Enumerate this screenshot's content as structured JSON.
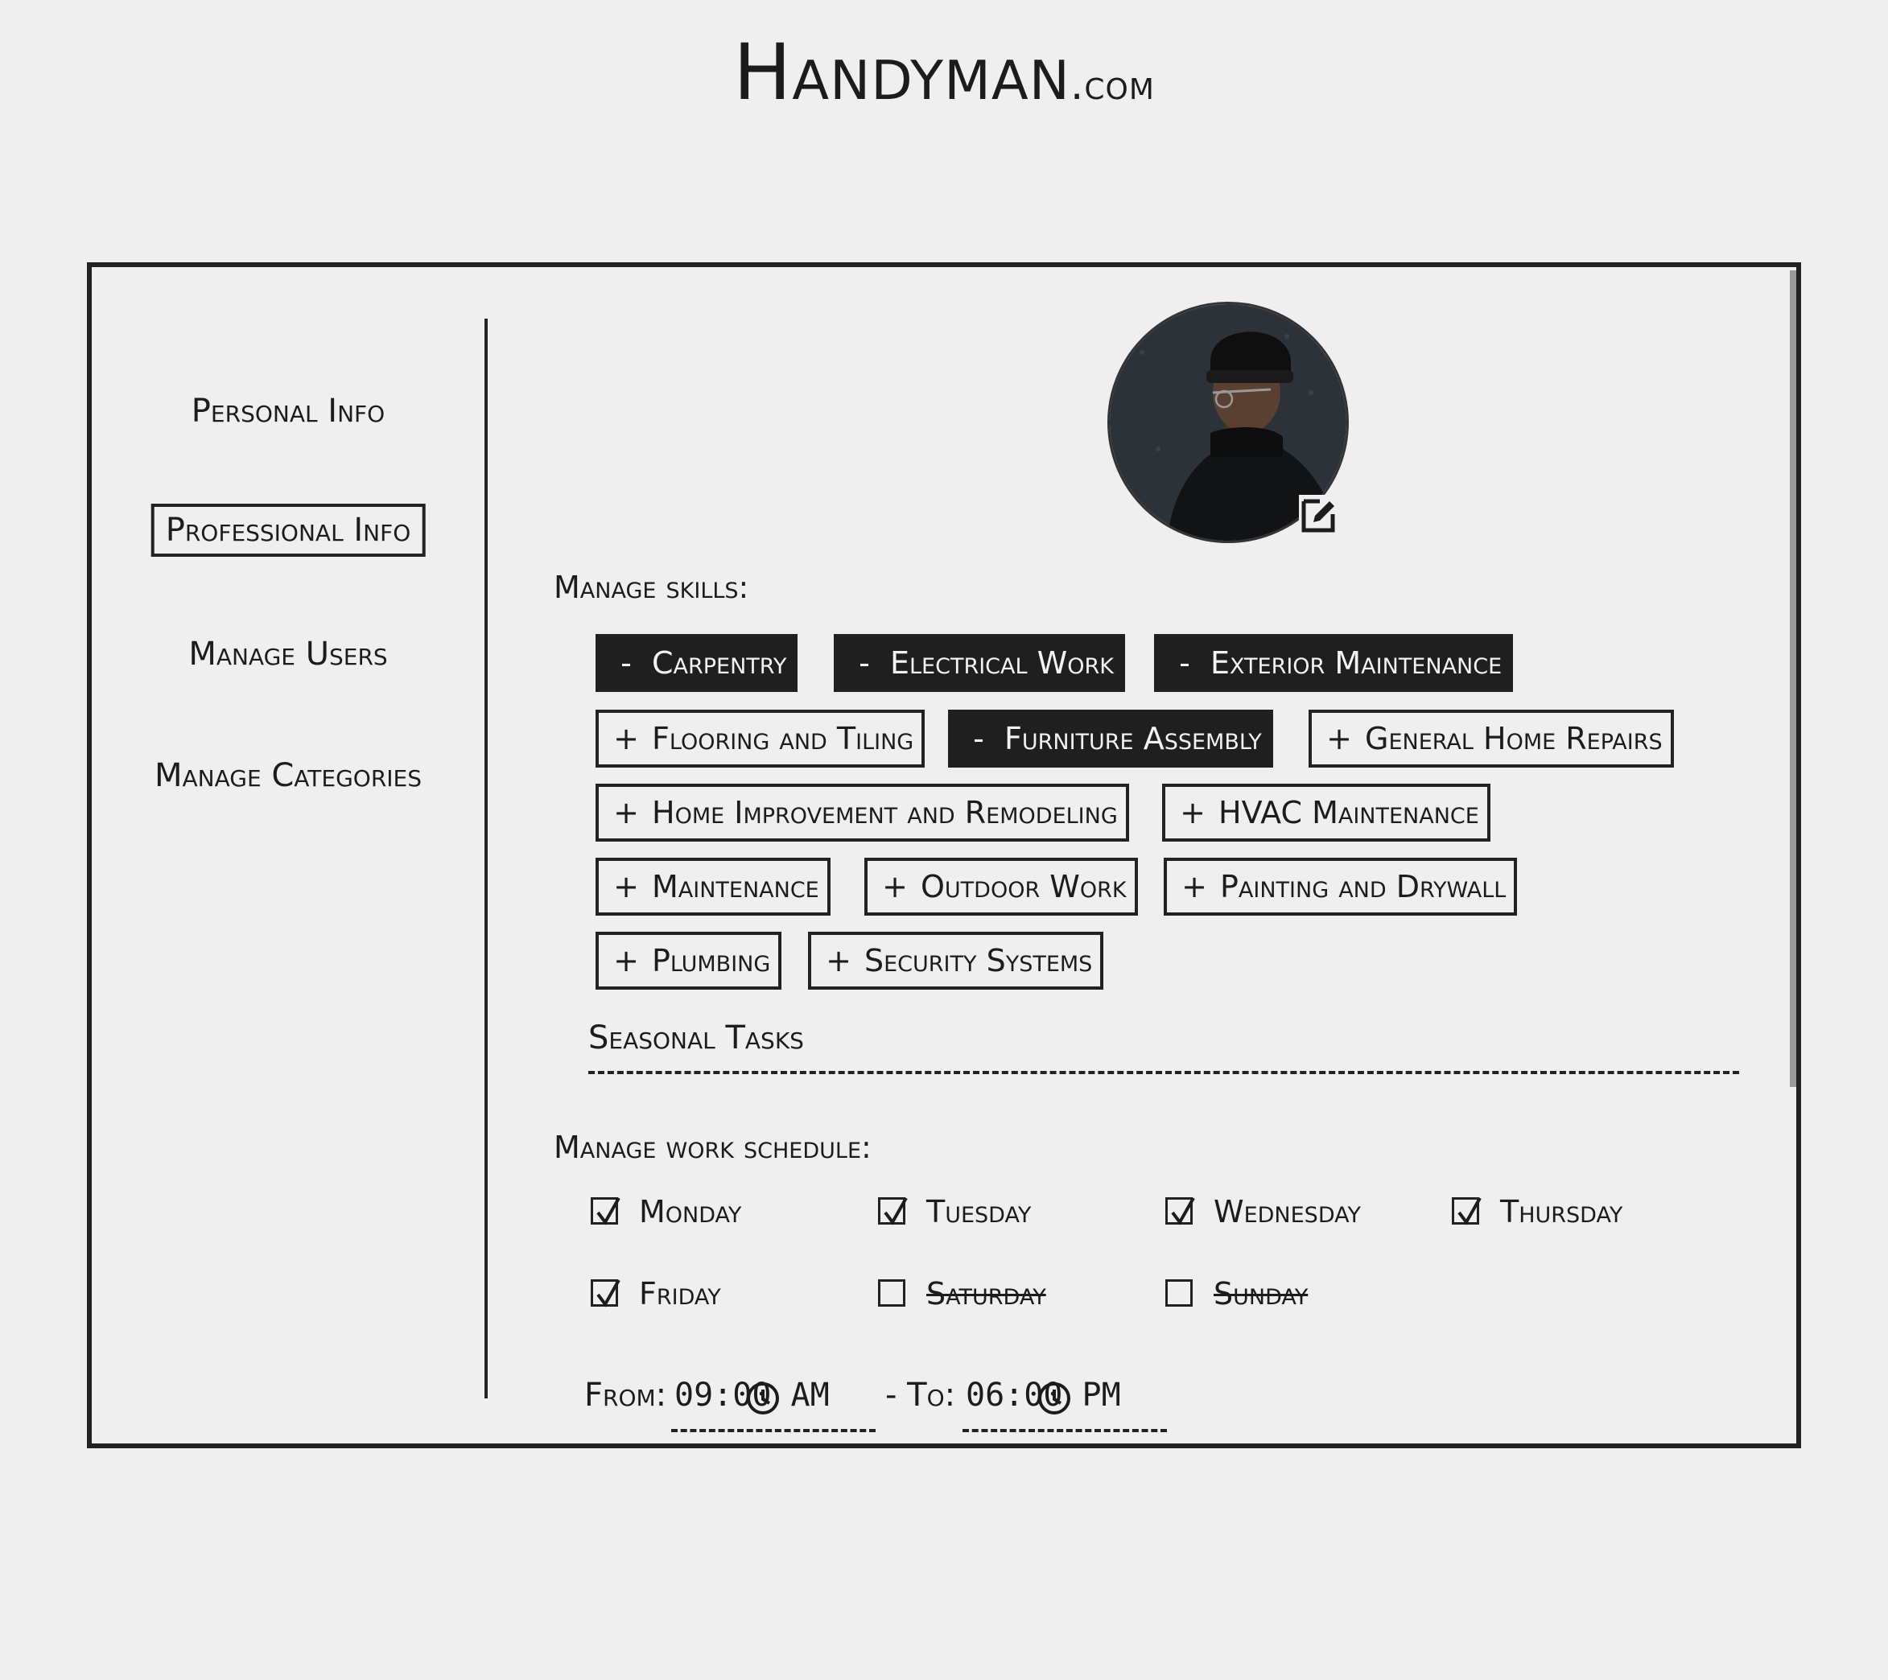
{
  "header": {
    "logo_main": "Handyman",
    "logo_domain": ".com"
  },
  "sidebar": {
    "items": [
      {
        "label": "Personal Info",
        "active": false
      },
      {
        "label": "Professional Info",
        "active": true
      },
      {
        "label": "Manage Users",
        "active": false
      },
      {
        "label": "Manage Categories",
        "active": false
      }
    ]
  },
  "profile": {
    "avatar_icon": "person-photo",
    "edit_icon": "edit-icon"
  },
  "skills": {
    "label": "Manage skills:",
    "remove_symbol": "-",
    "add_symbol": "+",
    "items": [
      {
        "label": "Carpentry",
        "selected": true
      },
      {
        "label": "Electrical Work",
        "selected": true
      },
      {
        "label": "Exterior Maintenance",
        "selected": true
      },
      {
        "label": "Flooring and Tiling",
        "selected": false
      },
      {
        "label": "Furniture Assembly",
        "selected": true
      },
      {
        "label": "General Home Repairs",
        "selected": false
      },
      {
        "label": "Home Improvement and Remodeling",
        "selected": false
      },
      {
        "label": "HVAC Maintenance",
        "selected": false
      },
      {
        "label": "Maintenance",
        "selected": false
      },
      {
        "label": "Outdoor Work",
        "selected": false
      },
      {
        "label": "Painting and Drywall",
        "selected": false
      },
      {
        "label": "Plumbing",
        "selected": false
      },
      {
        "label": "Security Systems",
        "selected": false
      }
    ],
    "new_skill_value": "Seasonal Tasks"
  },
  "schedule": {
    "label": "Manage work schedule:",
    "days": [
      {
        "label": "Monday",
        "checked": true
      },
      {
        "label": "Tuesday",
        "checked": true
      },
      {
        "label": "Wednesday",
        "checked": true
      },
      {
        "label": "Thursday",
        "checked": true
      },
      {
        "label": "Friday",
        "checked": true
      },
      {
        "label": "Saturday",
        "checked": false
      },
      {
        "label": "Sunday",
        "checked": false
      }
    ],
    "from_label": "From:",
    "from_value": "09:00 AM",
    "separator": "- To:",
    "to_value": "06:00 PM",
    "clock_icon": "clock-icon"
  },
  "colors": {
    "background": "#efefef",
    "ink": "#1c1c1c",
    "chip_selected": "#1f1f1f"
  }
}
